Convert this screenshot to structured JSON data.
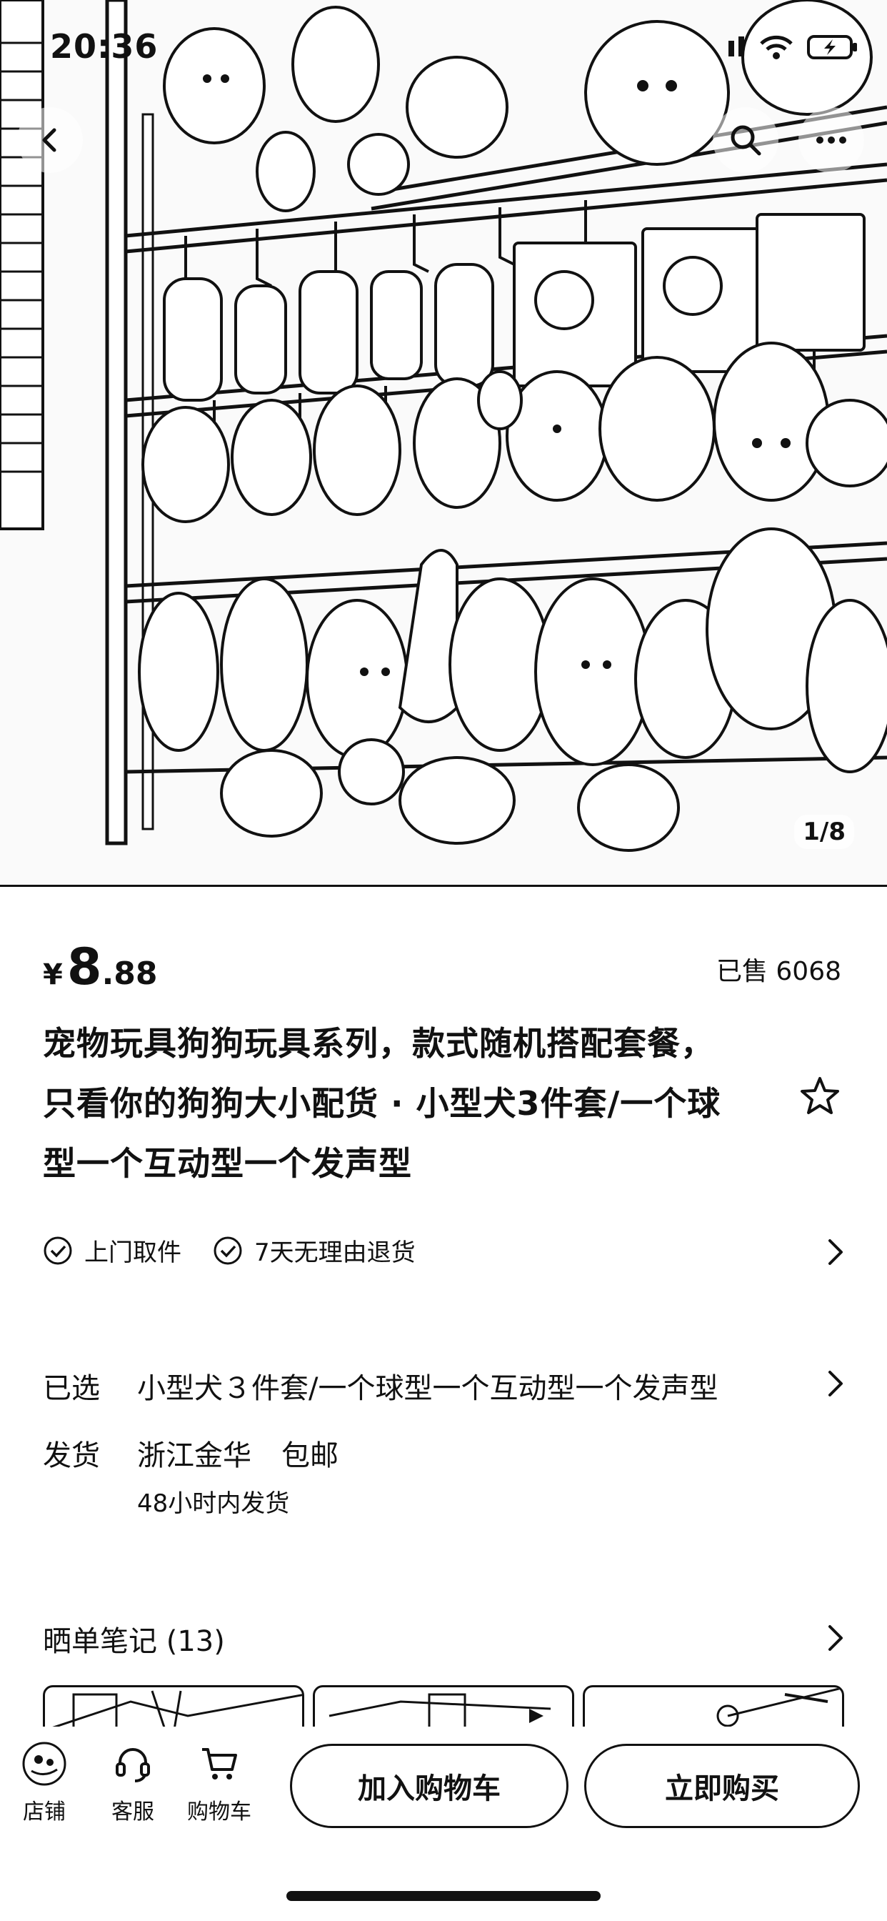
{
  "status_bar": {
    "time": "20:36"
  },
  "hero": {
    "page_indicator": "1/8"
  },
  "product": {
    "price_currency": "¥",
    "price_integer": "8",
    "price_decimal": ".88",
    "sold": "已售 6068",
    "title_lines": [
      "宠物玩具狗狗玩具系列，款式随机搭配套餐，",
      "只看你的狗狗大小配货 · 小型犬3件套/一个球",
      "型一个互动型一个发声型"
    ]
  },
  "services": [
    "上门取件",
    "7天无理由退货"
  ],
  "selection": {
    "label": "已选",
    "value": "小型犬３件套/一个球型一个互动型一个发声型"
  },
  "shipping": {
    "label": "发货",
    "origin": "浙江金华",
    "fee": "包邮",
    "time": "48小时内发货"
  },
  "notes": {
    "title": "晒单笔记 (13)"
  },
  "bottom_bar": {
    "shop": "店铺",
    "service": "客服",
    "cart": "购物车",
    "add_to_cart": "加入购物车",
    "buy_now": "立即购买"
  },
  "colors": {
    "ink": "#111111",
    "background": "#ffffff"
  }
}
